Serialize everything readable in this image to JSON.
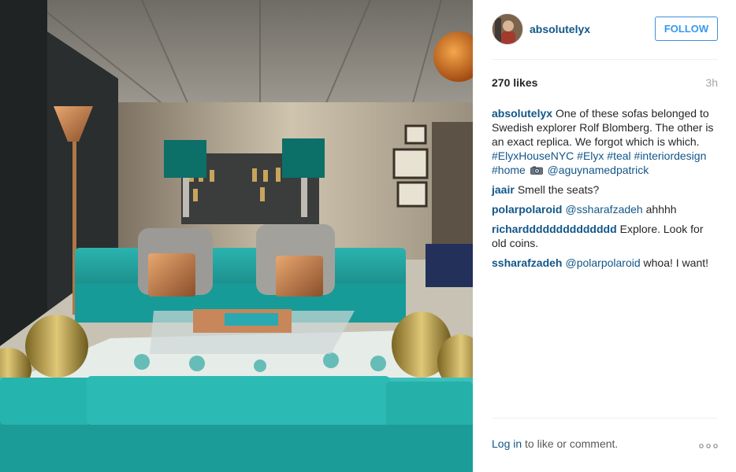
{
  "post": {
    "image_alt": "Living room with teal velvet sofas, copper lamps and gold ceramic stools",
    "header": {
      "username": "absolutelyx",
      "follow_label": "FOLLOW"
    },
    "likes": "270 likes",
    "time": "3h",
    "caption": {
      "user": "absolutelyx",
      "text": "One of these sofas belonged to Swedish explorer Rolf Blomberg. The other is an exact replica. We forgot which is which.",
      "hashtags": [
        "#ElyxHouseNYC",
        "#Elyx",
        "#teal",
        "#interiordesign",
        "#home"
      ],
      "emoji_icon": "camera-icon",
      "mention": "@aguynamedpatrick"
    },
    "comments": [
      {
        "user": "jaair",
        "mention": "",
        "text": "Smell the seats?"
      },
      {
        "user": "polarpolaroid",
        "mention": "@ssharafzadeh",
        "text": "ahhhh"
      },
      {
        "user": "richardddddddddddddd",
        "mention": "",
        "text": "Explore. Look for old coins."
      },
      {
        "user": "ssharafzadeh",
        "mention": "@polarpolaroid",
        "text": "whoa! I want!"
      }
    ],
    "footer": {
      "login_label": "Log in",
      "text": " to like or comment.",
      "more_icon": "more-options-icon"
    }
  },
  "colors": {
    "link": "#125688",
    "follow": "#3897f0",
    "muted": "#a5a7aa",
    "teal_sofa": "#1a9e9c"
  }
}
